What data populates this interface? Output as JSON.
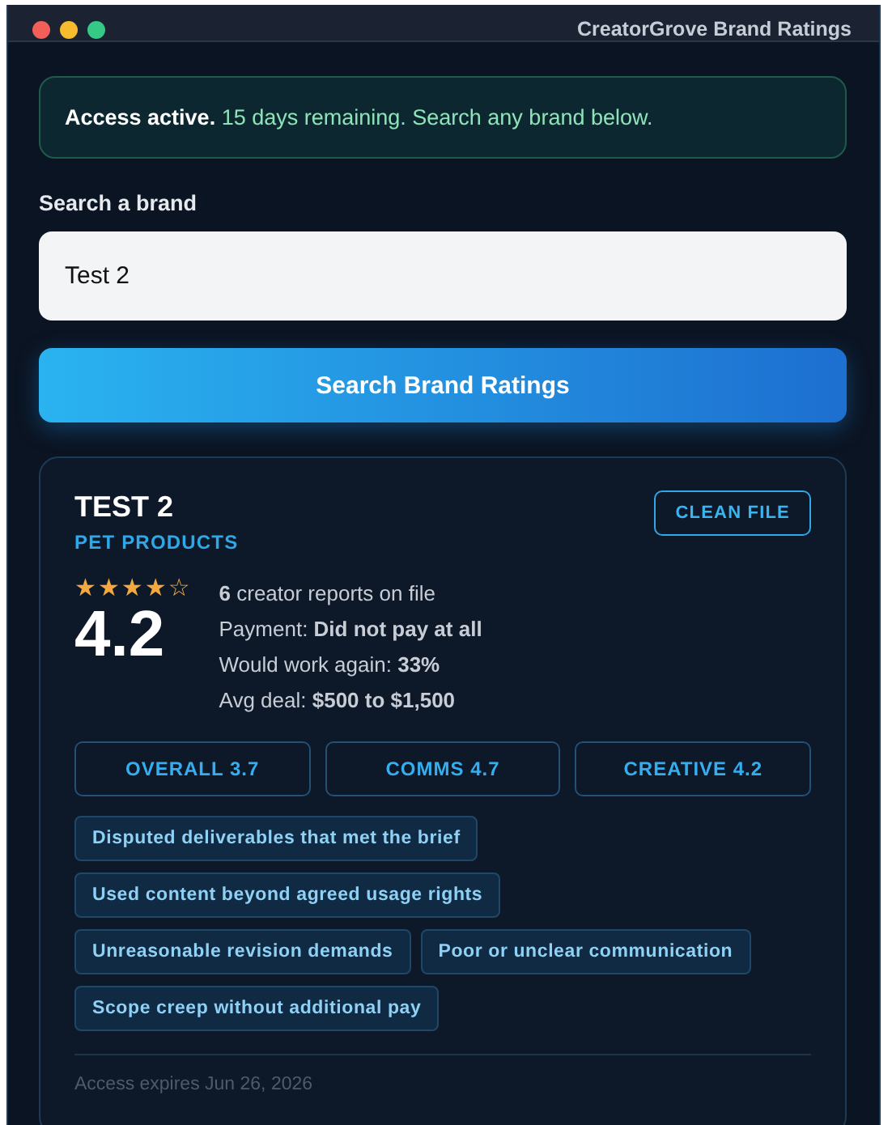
{
  "window": {
    "title": "CreatorGrove Brand Ratings"
  },
  "banner": {
    "text": "**Access active.** 15 days remaining. Search any brand below."
  },
  "search": {
    "label": "Search a brand",
    "value": "Test 2",
    "button": "Search Brand Ratings"
  },
  "result": {
    "name": "TEST 2",
    "category": "PET PRODUCTS",
    "badge": "CLEAN FILE",
    "stars": 4,
    "score": "4.2",
    "facts": [
      "**6** creator reports on file",
      "Payment: **Did not pay at all**",
      "Would work again: **33%**",
      "Avg deal: **$500 to $1,500**"
    ],
    "subscores": [
      "OVERALL 3.7",
      "COMMS 4.7",
      "CREATIVE 4.2"
    ],
    "tags": [
      "Disputed deliverables that met the brief",
      "Used content beyond agreed usage rights",
      "Unreasonable revision demands",
      "Poor or unclear communication",
      "Scope creep without additional pay"
    ],
    "footer": "Access expires Jun 26, 2026"
  }
}
